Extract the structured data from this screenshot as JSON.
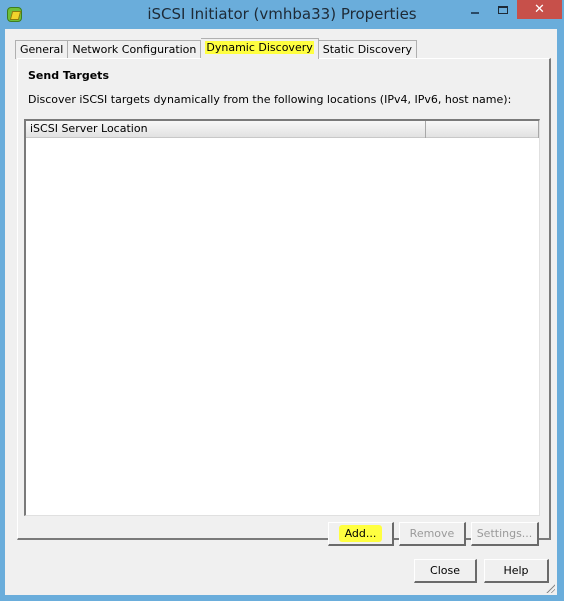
{
  "window": {
    "title": "iSCSI Initiator (vmhba33) Properties",
    "icon": "vsphere-app-icon",
    "controls": {
      "minimize": "minimize-icon",
      "maximize": "maximize-icon",
      "close_glyph": "✕"
    }
  },
  "tabs": [
    {
      "label": "General",
      "active": false
    },
    {
      "label": "Network Configuration",
      "active": false
    },
    {
      "label": "Dynamic Discovery",
      "active": true,
      "highlighted": true
    },
    {
      "label": "Static Discovery",
      "active": false
    }
  ],
  "panel": {
    "section_title": "Send Targets",
    "description": "Discover iSCSI targets dynamically from the following locations (IPv4, IPv6, host name):",
    "table": {
      "columns": [
        "iSCSI Server Location",
        ""
      ],
      "rows": []
    },
    "buttons": {
      "add": {
        "label": "Add...",
        "enabled": true,
        "highlighted": true
      },
      "remove": {
        "label": "Remove",
        "enabled": false
      },
      "settings": {
        "label": "Settings...",
        "enabled": false
      }
    }
  },
  "footer": {
    "close_label": "Close",
    "help_label": "Help"
  },
  "colors": {
    "titlebar": "#6aaddb",
    "close_button": "#c7504a",
    "highlight": "#ffff40",
    "dialog_bg": "#f0f0f0"
  }
}
